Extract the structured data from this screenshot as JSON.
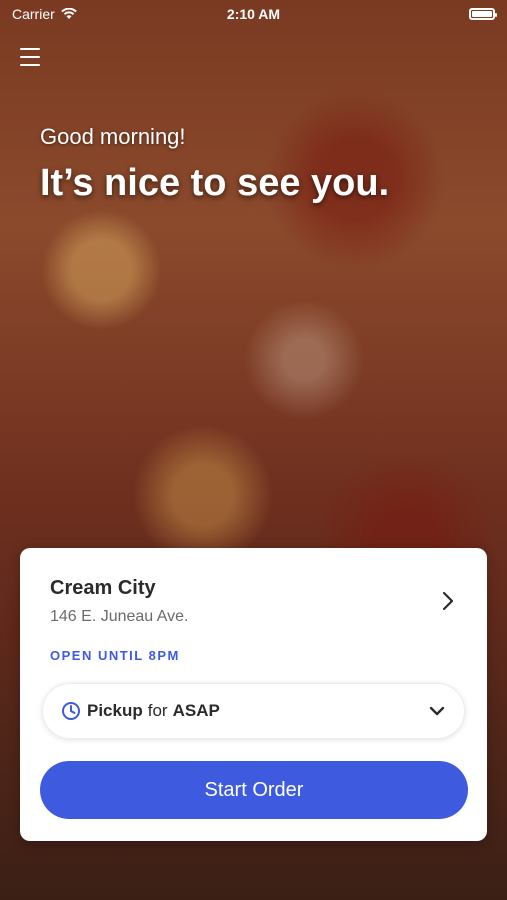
{
  "status_bar": {
    "carrier": "Carrier",
    "time": "2:10 AM"
  },
  "greeting": {
    "subtitle": "Good morning!",
    "title": "It’s nice to see you."
  },
  "location": {
    "name": "Cream City",
    "address": "146 E. Juneau Ave.",
    "hours": "OPEN UNTIL 8PM"
  },
  "order_mode": {
    "mode": "Pickup",
    "connector": "for",
    "time": "ASAP"
  },
  "actions": {
    "start_order": "Start Order"
  },
  "colors": {
    "accent": "#3e5be0",
    "text": "#2b2b2b",
    "muted": "#6b6b6b"
  }
}
